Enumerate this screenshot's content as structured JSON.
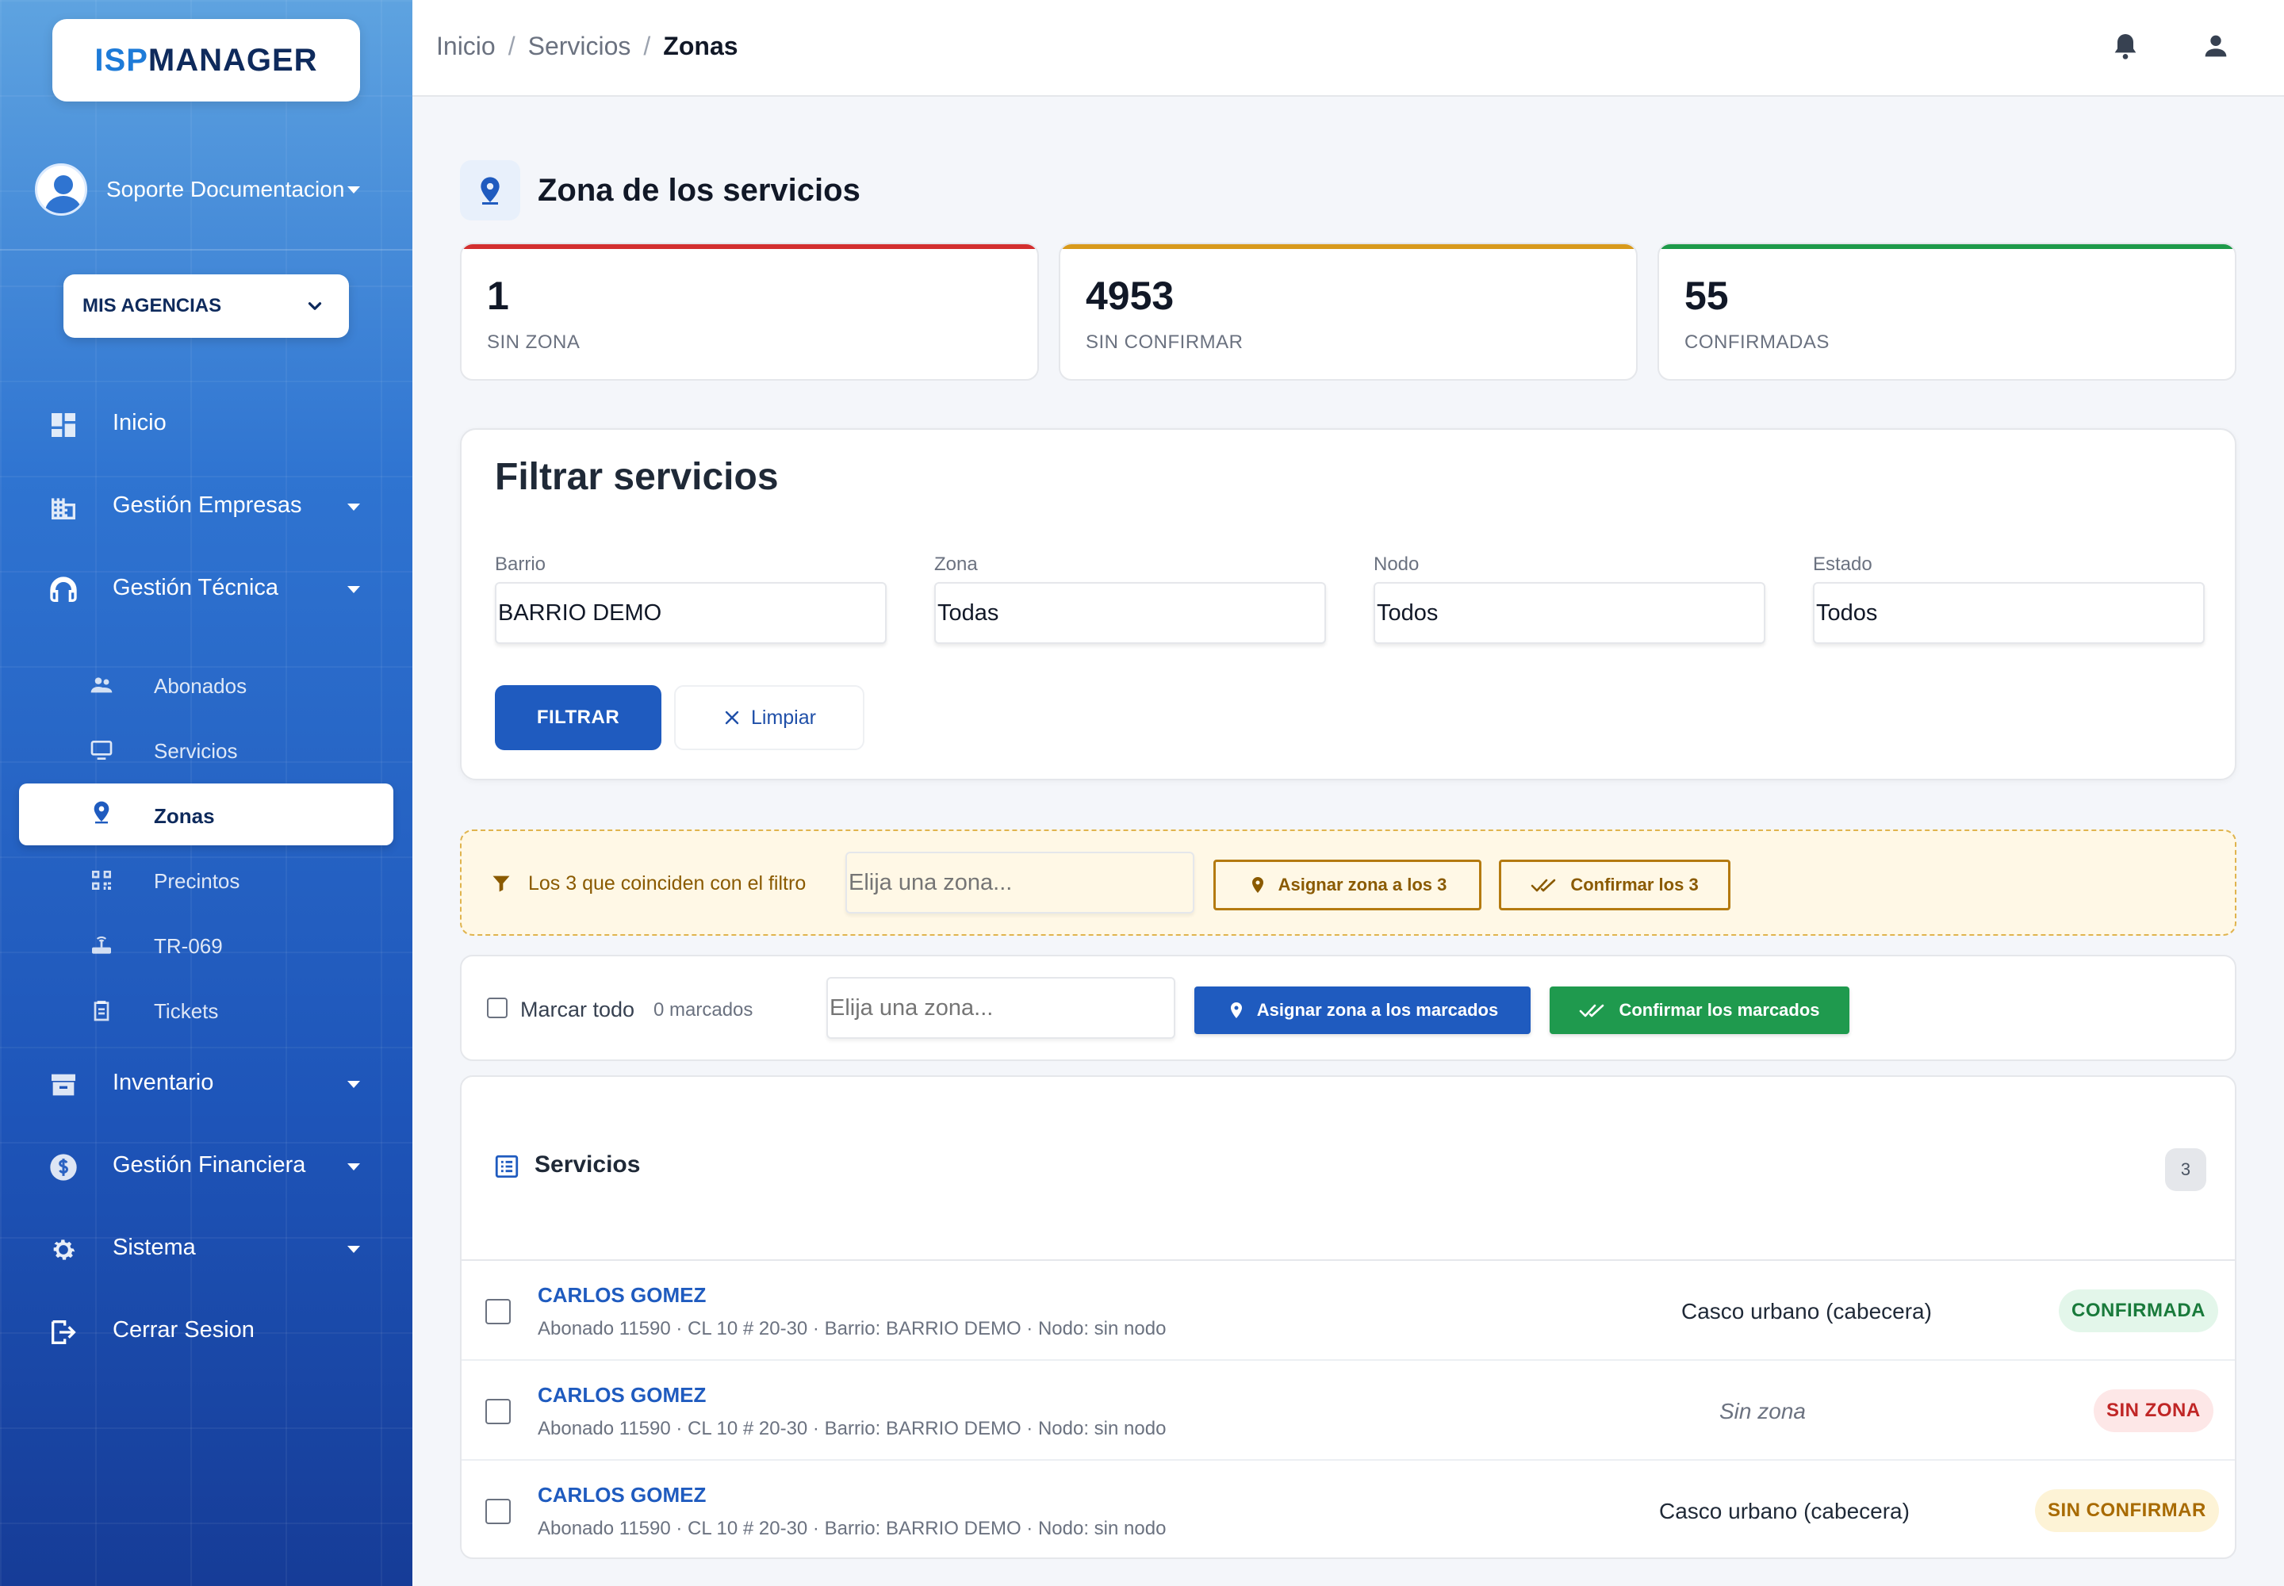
{
  "brand": {
    "part1": "ISP",
    "part2": "MANAGER"
  },
  "user": {
    "name": "Soporte Documentacion"
  },
  "agency": {
    "label": "MIS AGENCIAS"
  },
  "nav": {
    "inicio": "Inicio",
    "empresas": "Gestión Empresas",
    "tecnica": "Gestión Técnica",
    "sub": {
      "abonados": "Abonados",
      "servicios": "Servicios",
      "zonas": "Zonas",
      "precintos": "Precintos",
      "tr069": "TR-069",
      "tickets": "Tickets"
    },
    "inventario": "Inventario",
    "financiera": "Gestión Financiera",
    "sistema": "Sistema",
    "cerrar": "Cerrar Sesion"
  },
  "breadcrumb": {
    "home": "Inicio",
    "section": "Servicios",
    "current": "Zonas"
  },
  "page": {
    "title": "Zona de los servicios"
  },
  "stats": [
    {
      "value": "1",
      "label": "SIN ZONA",
      "color": "#d32f2f"
    },
    {
      "value": "4953",
      "label": "SIN CONFIRMAR",
      "color": "#d89a1c"
    },
    {
      "value": "55",
      "label": "CONFIRMADAS",
      "color": "#1e9a4a"
    }
  ],
  "filter": {
    "title": "Filtrar servicios",
    "barrio": {
      "label": "Barrio",
      "value": "BARRIO DEMO"
    },
    "zona": {
      "label": "Zona",
      "value": "Todas"
    },
    "nodo": {
      "label": "Nodo",
      "value": "Todos"
    },
    "estado": {
      "label": "Estado",
      "value": "Todos"
    },
    "apply": "FILTRAR",
    "clear": "Limpiar"
  },
  "bulk_filter": {
    "text": "Los 3 que coinciden con el filtro",
    "placeholder": "Elija una zona...",
    "assign": "Asignar zona a los 3",
    "confirm": "Confirmar los 3"
  },
  "bulk_mark": {
    "mark_all": "Marcar todo",
    "marked": "0 marcados",
    "placeholder": "Elija una zona...",
    "assign": "Asignar zona a los marcados",
    "confirm": "Confirmar los marcados"
  },
  "list": {
    "title": "Servicios",
    "count": "3",
    "rows": [
      {
        "name": "CARLOS GOMEZ",
        "details": "Abonado 11590 · CL 10 # 20-30 · Barrio: BARRIO DEMO · Nodo: sin nodo",
        "zone": "Casco urbano (cabecera)",
        "status": "CONFIRMADA"
      },
      {
        "name": "CARLOS GOMEZ",
        "details": "Abonado 11590 · CL 10 # 20-30 · Barrio: BARRIO DEMO · Nodo: sin nodo",
        "zone": "Sin zona",
        "status": "SIN ZONA"
      },
      {
        "name": "CARLOS GOMEZ",
        "details": "Abonado 11590 · CL 10 # 20-30 · Barrio: BARRIO DEMO · Nodo: sin nodo",
        "zone": "Casco urbano (cabecera)",
        "status": "SIN CONFIRMAR"
      }
    ]
  }
}
